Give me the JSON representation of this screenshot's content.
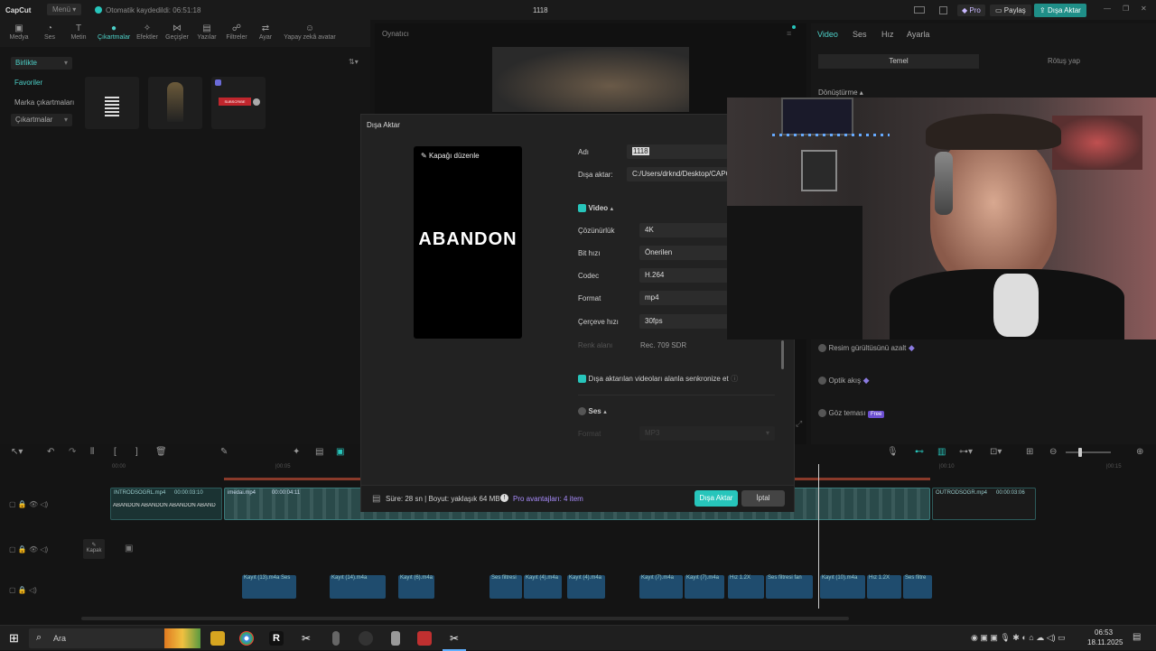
{
  "titlebar": {
    "logo": "CapCut",
    "menu": "Menü",
    "autosave": "Otomatik kaydedildi: 06:51:18",
    "project": "1118",
    "pro": "Pro",
    "share": "Paylaş",
    "export": "Dışa Aktar"
  },
  "tools": [
    "Medya",
    "Ses",
    "Metin",
    "Çıkartmalar",
    "Efektler",
    "Geçişler",
    "Yazılar",
    "Filtreler",
    "Ayar",
    "Yapay zekâ avatar"
  ],
  "left": {
    "dropdown": "Birlikte",
    "items": [
      "Favoriler",
      "Marka çıkartmaları",
      "Çıkartmalar"
    ],
    "sticker_text": "SUBSCRIBE"
  },
  "player": {
    "title": "Oynatıcı"
  },
  "right": {
    "tabs": [
      "Video",
      "Ses",
      "Hız",
      "Ayarla"
    ],
    "subtabs": [
      "Temel",
      "Rötuş yap"
    ],
    "section": "Dönüştürme",
    "options": [
      "Resim gürültüsünü azalt",
      "Optik akış",
      "Göz teması"
    ],
    "free_badge": "Free"
  },
  "dialog": {
    "title": "Dışa Aktar",
    "edit_cover": "Kapağı düzenle",
    "cover_text": "ABANDON",
    "name_label": "Adı",
    "name_value": "1118",
    "export_label": "Dışa aktar:",
    "export_path": "C:/Users/drknd/Desktop/CAPCU",
    "video_section": "Video",
    "resolution_label": "Çözünürlük",
    "resolution_value": "4K",
    "bitrate_label": "Bit hızı",
    "bitrate_value": "Önerilen",
    "codec_label": "Codec",
    "codec_value": "H.264",
    "format_label": "Format",
    "format_value": "mp4",
    "fps_label": "Çerçeve hızı",
    "fps_value": "30fps",
    "color_label": "Renk alanı",
    "color_value": "Rec. 709 SDR",
    "sync_label": "Dışa aktarılan videoları alanla senkronize et",
    "audio_section": "Ses",
    "audio_format_label": "Format",
    "audio_format_value": "MP3",
    "footer_info": "Süre: 28 sn | Boyut: yaklaşık 64 MB",
    "pro_info": "Pro avantajları: 4 item",
    "export_button": "Dışa Aktar",
    "cancel_button": "İptal"
  },
  "timeline": {
    "ruler": [
      "00:00",
      "|00:05",
      "|00:10",
      "|00:15"
    ],
    "clips": [
      {
        "name": "INTRODSOGRL.mp4",
        "dur": "00:00:03:10",
        "caption": "ABANDON ABANDON ABANDON ABAND"
      },
      {
        "name": "imedai.mp4",
        "dur": "00:00:04:11"
      },
      {
        "name": "OUTRODSOGR.mp4",
        "dur": "00:00:03:06"
      }
    ],
    "cover_label": "Kapak",
    "audio_clips": [
      "Kayıt (13).m4a",
      "Ses",
      "Kayıt (14).m4a",
      "Kayıt (6).m4a",
      "Ses filtresi",
      "Kayıt (4).m4a",
      "Kayıt (4).m4a",
      "Kayıt (7).m4a",
      "Kayıt (7).m4a",
      "Hız 1.2X",
      "Ses filtresi fan",
      "Kayıt (10).m4a",
      "Hız 1.2X",
      "Ses filtre"
    ]
  },
  "taskbar": {
    "search": "Ara",
    "time": "06:53",
    "date": "18.11.2025"
  },
  "colors": {
    "accent": "#27c5bb",
    "pro": "#a78bfa",
    "clip_video": "#1e5a5a",
    "clip_audio": "#1f4c6e"
  }
}
